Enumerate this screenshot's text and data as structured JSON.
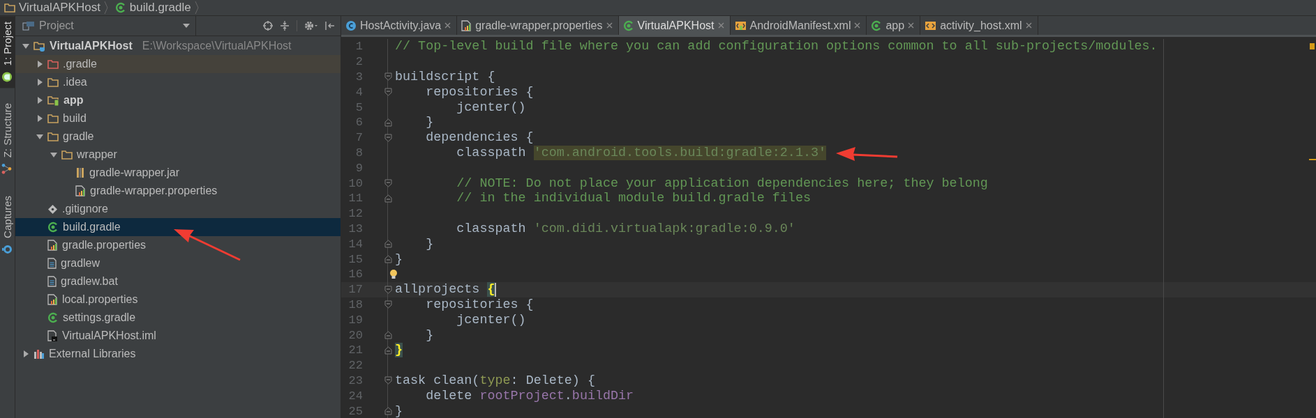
{
  "breadcrumb": [
    {
      "label": "VirtualAPKHost",
      "kind": "folder"
    },
    {
      "label": "build.gradle",
      "kind": "gradle"
    }
  ],
  "side_tabs": [
    {
      "label": "1: Project",
      "kind": "android",
      "selected": true
    },
    {
      "label": "Z: Structure",
      "kind": "structure",
      "selected": false
    },
    {
      "label": "Captures",
      "kind": "captures",
      "selected": false
    }
  ],
  "project": {
    "title": "Project",
    "tree": [
      {
        "name": "VirtualAPKHost",
        "path": "E:\\Workspace\\VirtualAPKHost",
        "kind": "project-root",
        "expanded": true,
        "selected": false,
        "children": [
          {
            "name": ".gradle",
            "kind": "excluded-folder",
            "expanded": false,
            "selected": false
          },
          {
            "name": ".idea",
            "kind": "folder",
            "expanded": false,
            "selected": false
          },
          {
            "name": "app",
            "kind": "module-folder",
            "expanded": false,
            "selected": false
          },
          {
            "name": "build",
            "kind": "folder",
            "expanded": false,
            "selected": false
          },
          {
            "name": "gradle",
            "kind": "folder",
            "expanded": true,
            "selected": false,
            "children": [
              {
                "name": "wrapper",
                "kind": "folder",
                "expanded": true,
                "selected": false,
                "children": [
                  {
                    "name": "gradle-wrapper.jar",
                    "kind": "jar",
                    "selected": false
                  },
                  {
                    "name": "gradle-wrapper.properties",
                    "kind": "properties-file",
                    "selected": false
                  }
                ]
              }
            ]
          },
          {
            "name": ".gitignore",
            "kind": "git-file",
            "selected": false
          },
          {
            "name": "build.gradle",
            "kind": "gradle-file",
            "selected": true
          },
          {
            "name": "gradle.properties",
            "kind": "properties-file",
            "selected": false
          },
          {
            "name": "gradlew",
            "kind": "text-file",
            "selected": false
          },
          {
            "name": "gradlew.bat",
            "kind": "text-file",
            "selected": false
          },
          {
            "name": "local.properties",
            "kind": "properties-file",
            "selected": false
          },
          {
            "name": "settings.gradle",
            "kind": "gradle-file",
            "selected": false
          },
          {
            "name": "VirtualAPKHost.iml",
            "kind": "iml-file",
            "selected": false
          }
        ]
      },
      {
        "name": "External Libraries",
        "kind": "libraries",
        "expanded": false,
        "selected": false
      }
    ]
  },
  "tabs": [
    {
      "label": "HostActivity.java",
      "kind": "java",
      "selected": false
    },
    {
      "label": "gradle-wrapper.properties",
      "kind": "properties",
      "selected": false
    },
    {
      "label": "VirtualAPKHost",
      "kind": "gradle",
      "selected": true
    },
    {
      "label": "AndroidManifest.xml",
      "kind": "manifest",
      "selected": false
    },
    {
      "label": "app",
      "kind": "gradle",
      "selected": false
    },
    {
      "label": "activity_host.xml",
      "kind": "layout",
      "selected": false
    }
  ],
  "editor": {
    "lines": [
      {
        "number": "1",
        "kind": "plain",
        "current": false,
        "tokens": [
          {
            "text": "// Top-level build file where you can add configuration options common to all sub-projects/modules.",
            "kind": "comment"
          }
        ]
      },
      {
        "number": "2",
        "kind": "plain",
        "current": false
      },
      {
        "number": "3",
        "kind": "fold-start",
        "current": false,
        "tokens": [
          {
            "text": "buildscript {",
            "kind": "plain"
          }
        ]
      },
      {
        "number": "4",
        "kind": "fold-start",
        "current": false,
        "tokens": [
          {
            "text": "    repositories {",
            "kind": "plain"
          }
        ]
      },
      {
        "number": "5",
        "kind": "plain",
        "current": false,
        "tokens": [
          {
            "text": "        jcenter()",
            "kind": "plain"
          }
        ]
      },
      {
        "number": "6",
        "kind": "fold-end",
        "current": false,
        "tokens": [
          {
            "text": "    }",
            "kind": "plain"
          }
        ]
      },
      {
        "number": "7",
        "kind": "fold-start",
        "current": false,
        "tokens": [
          {
            "text": "    dependencies {",
            "kind": "plain"
          }
        ]
      },
      {
        "number": "8",
        "kind": "plain",
        "current": false,
        "tokens": [
          {
            "text": "        classpath ",
            "kind": "plain"
          },
          {
            "text": "'com.android.tools.build:gradle:2.1.3'",
            "kind": "highlighted-string"
          }
        ]
      },
      {
        "number": "9",
        "kind": "plain",
        "current": false
      },
      {
        "number": "10",
        "kind": "fold-start",
        "current": false,
        "tokens": [
          {
            "text": "        // NOTE: Do not place your application dependencies here; they belong",
            "kind": "comment"
          }
        ]
      },
      {
        "number": "11",
        "kind": "fold-end",
        "current": false,
        "tokens": [
          {
            "text": "        // in the individual module build.gradle files",
            "kind": "comment"
          }
        ]
      },
      {
        "number": "12",
        "kind": "plain",
        "current": false
      },
      {
        "number": "13",
        "kind": "plain",
        "current": false,
        "tokens": [
          {
            "text": "        classpath ",
            "kind": "plain"
          },
          {
            "text": "'com.didi.virtualapk:gradle:0.9.0'",
            "kind": "string"
          }
        ]
      },
      {
        "number": "14",
        "kind": "fold-end",
        "current": false,
        "tokens": [
          {
            "text": "    }",
            "kind": "plain"
          }
        ]
      },
      {
        "number": "15",
        "kind": "fold-end",
        "current": false,
        "tokens": [
          {
            "text": "}",
            "kind": "plain"
          }
        ]
      },
      {
        "number": "16",
        "kind": "bulb",
        "current": false
      },
      {
        "number": "17",
        "kind": "fold-start",
        "current": true,
        "tokens": [
          {
            "text": "allprojects ",
            "kind": "plain"
          },
          {
            "text": "{",
            "kind": "brace-match"
          }
        ]
      },
      {
        "number": "18",
        "kind": "fold-start",
        "current": false,
        "tokens": [
          {
            "text": "    repositories {",
            "kind": "plain"
          }
        ]
      },
      {
        "number": "19",
        "kind": "plain",
        "current": false,
        "tokens": [
          {
            "text": "        jcenter()",
            "kind": "plain"
          }
        ]
      },
      {
        "number": "20",
        "kind": "fold-end",
        "current": false,
        "tokens": [
          {
            "text": "    }",
            "kind": "plain"
          }
        ]
      },
      {
        "number": "21",
        "kind": "fold-end",
        "current": false,
        "tokens": [
          {
            "text": "}",
            "kind": "brace-match"
          }
        ]
      },
      {
        "number": "22",
        "kind": "plain",
        "current": false
      },
      {
        "number": "23",
        "kind": "fold-start",
        "current": false,
        "tokens": [
          {
            "text": "task clean(",
            "kind": "plain"
          },
          {
            "text": "type",
            "kind": "named-arg"
          },
          {
            "text": ": Delete) {",
            "kind": "plain"
          }
        ]
      },
      {
        "number": "24",
        "kind": "plain",
        "current": false,
        "tokens": [
          {
            "text": "    delete ",
            "kind": "plain"
          },
          {
            "text": "rootProject",
            "kind": "field"
          },
          {
            "text": ".",
            "kind": "plain"
          },
          {
            "text": "buildDir",
            "kind": "field"
          }
        ]
      },
      {
        "number": "25",
        "kind": "fold-end",
        "current": false,
        "tokens": [
          {
            "text": "}",
            "kind": "plain"
          }
        ]
      }
    ]
  }
}
